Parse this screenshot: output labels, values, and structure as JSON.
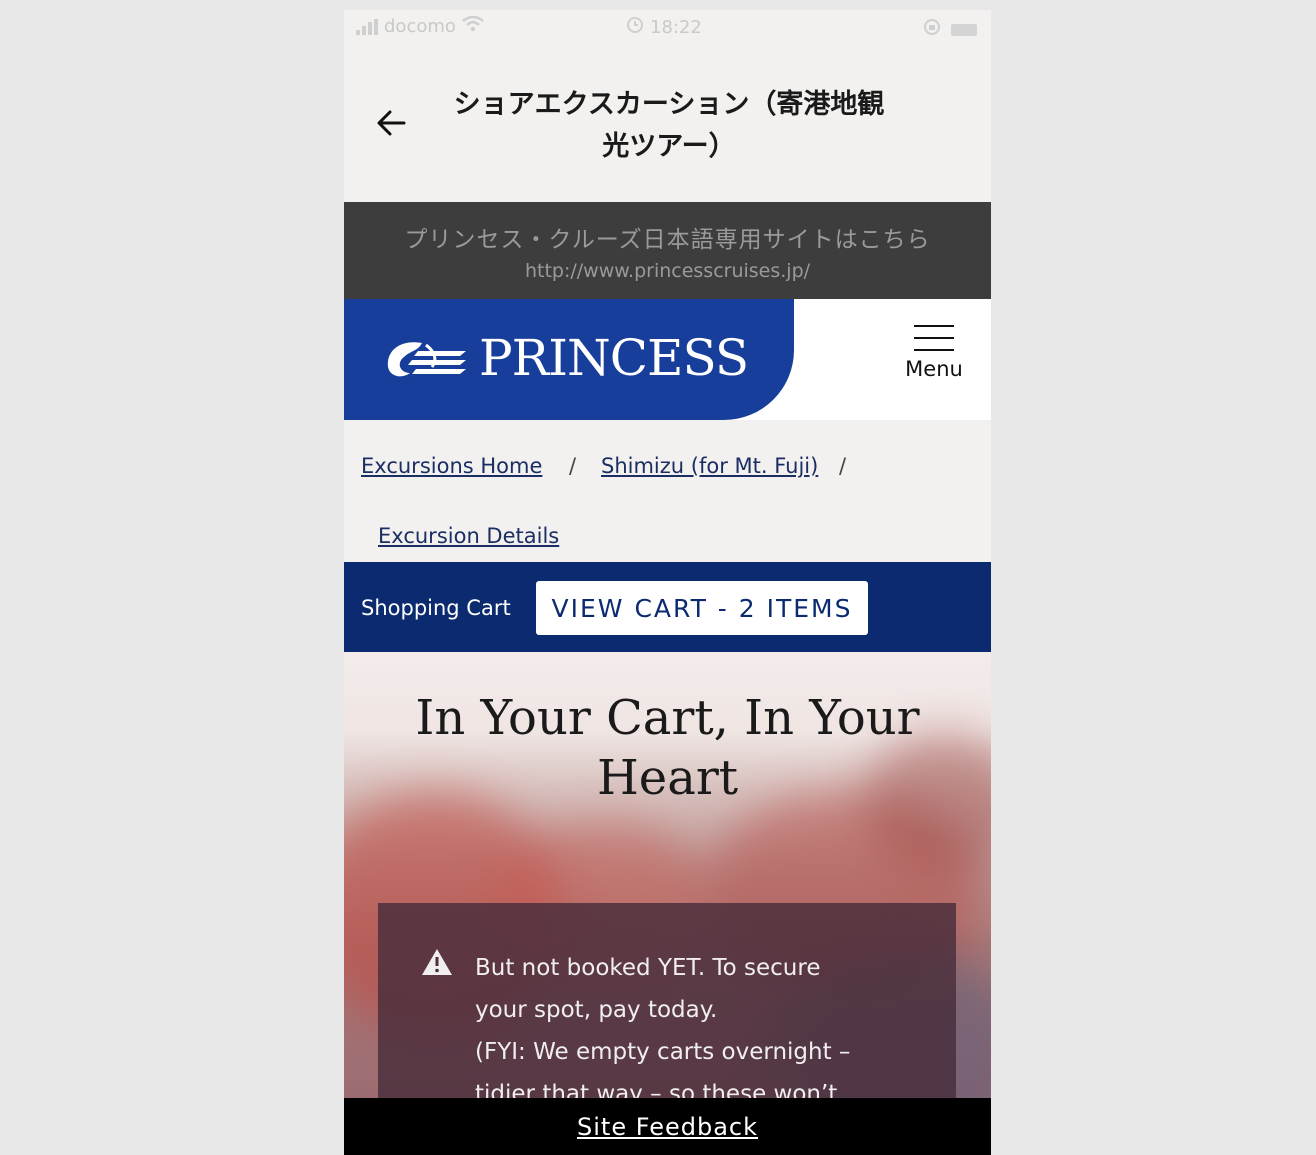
{
  "status_bar": {
    "carrier": "docomo",
    "time": "18:22"
  },
  "header": {
    "title_line1": "ショアエクスカーション（寄港地観",
    "title_line2": "光ツアー）"
  },
  "jp_banner": {
    "line1": "プリンセス・クルーズ日本語専用サイトはこちら",
    "url": "http://www.princesscruises.jp/"
  },
  "navbar": {
    "logo_text": "PRINCESS",
    "menu_label": "Menu",
    "brand_color": "#173e9b"
  },
  "breadcrumbs": {
    "items": [
      "Excursions Home",
      "Shimizu (for Mt. Fuji)",
      "Excursion Details"
    ],
    "separator": "/"
  },
  "cart": {
    "label": "Shopping Cart",
    "button_label": "VIEW CART - 2 ITEMS",
    "bar_color": "#0b2a70"
  },
  "hero": {
    "title_line1": "In Your Cart, In Your",
    "title_line2": "Heart"
  },
  "notice": {
    "lines": [
      "But not booked YET. To secure",
      "your spot, pay today.",
      "(FYI: We empty carts overnight –",
      "tidier that way – so these won’t"
    ]
  },
  "footer": {
    "feedback_label": "Site Feedback"
  }
}
